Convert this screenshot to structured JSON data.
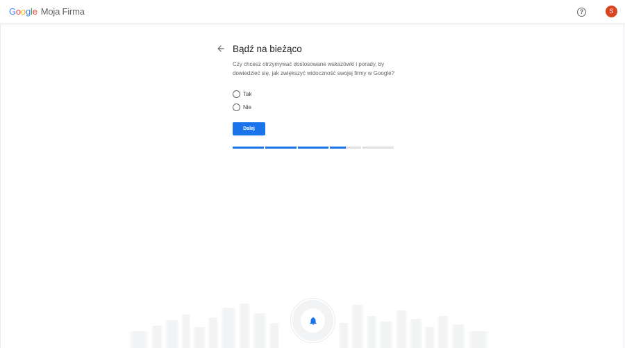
{
  "header": {
    "logo_letters": [
      "G",
      "o",
      "o",
      "g",
      "l",
      "e"
    ],
    "logo_colors": [
      "#4285f4",
      "#ea4335",
      "#fbbc05",
      "#4285f4",
      "#34a853",
      "#ea4335"
    ],
    "product_name": "Moja Firma",
    "help_icon": "help-circle-icon",
    "help_glyph": "?",
    "avatar_initial": "S",
    "avatar_color": "#d9431f"
  },
  "step": {
    "back_icon": "arrow-back-icon",
    "title": "Bądź na bieżąco",
    "question": "Czy chcesz otrzymywać dostosowane wskazówki i porady, by dowiedzieć się, jak zwiększyć widoczność swojej firmy w Google?",
    "options": [
      {
        "label": "Tak",
        "selected": false
      },
      {
        "label": "Nie",
        "selected": false
      }
    ],
    "next_label": "Dalej",
    "accent_color": "#1a73e8"
  },
  "progress": {
    "segments": [
      1,
      1,
      1,
      0.5,
      0
    ]
  },
  "illustration": {
    "icon": "bell-icon"
  }
}
